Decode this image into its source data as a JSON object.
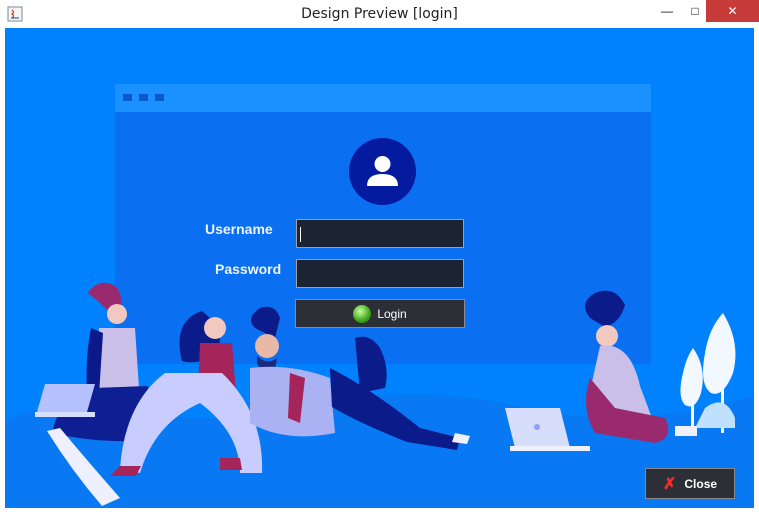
{
  "window": {
    "title": "Design Preview [login]",
    "controls": {
      "minimize": "—",
      "maximize": "□",
      "close": "✕"
    }
  },
  "login_form": {
    "username_label": "Username",
    "password_label": "Password",
    "username_value": "",
    "password_value": "",
    "login_button_label": "Login"
  },
  "close_button_label": "Close",
  "colors": {
    "background": "#0082ff",
    "panel": "#0a6ff0",
    "field": "#1c2433",
    "button": "#2c2f36",
    "avatar": "#041a9f",
    "close_x": "#ff2a2a"
  },
  "icons": [
    "java-app-icon",
    "user-avatar-icon",
    "login-ball-icon",
    "close-x-icon"
  ]
}
